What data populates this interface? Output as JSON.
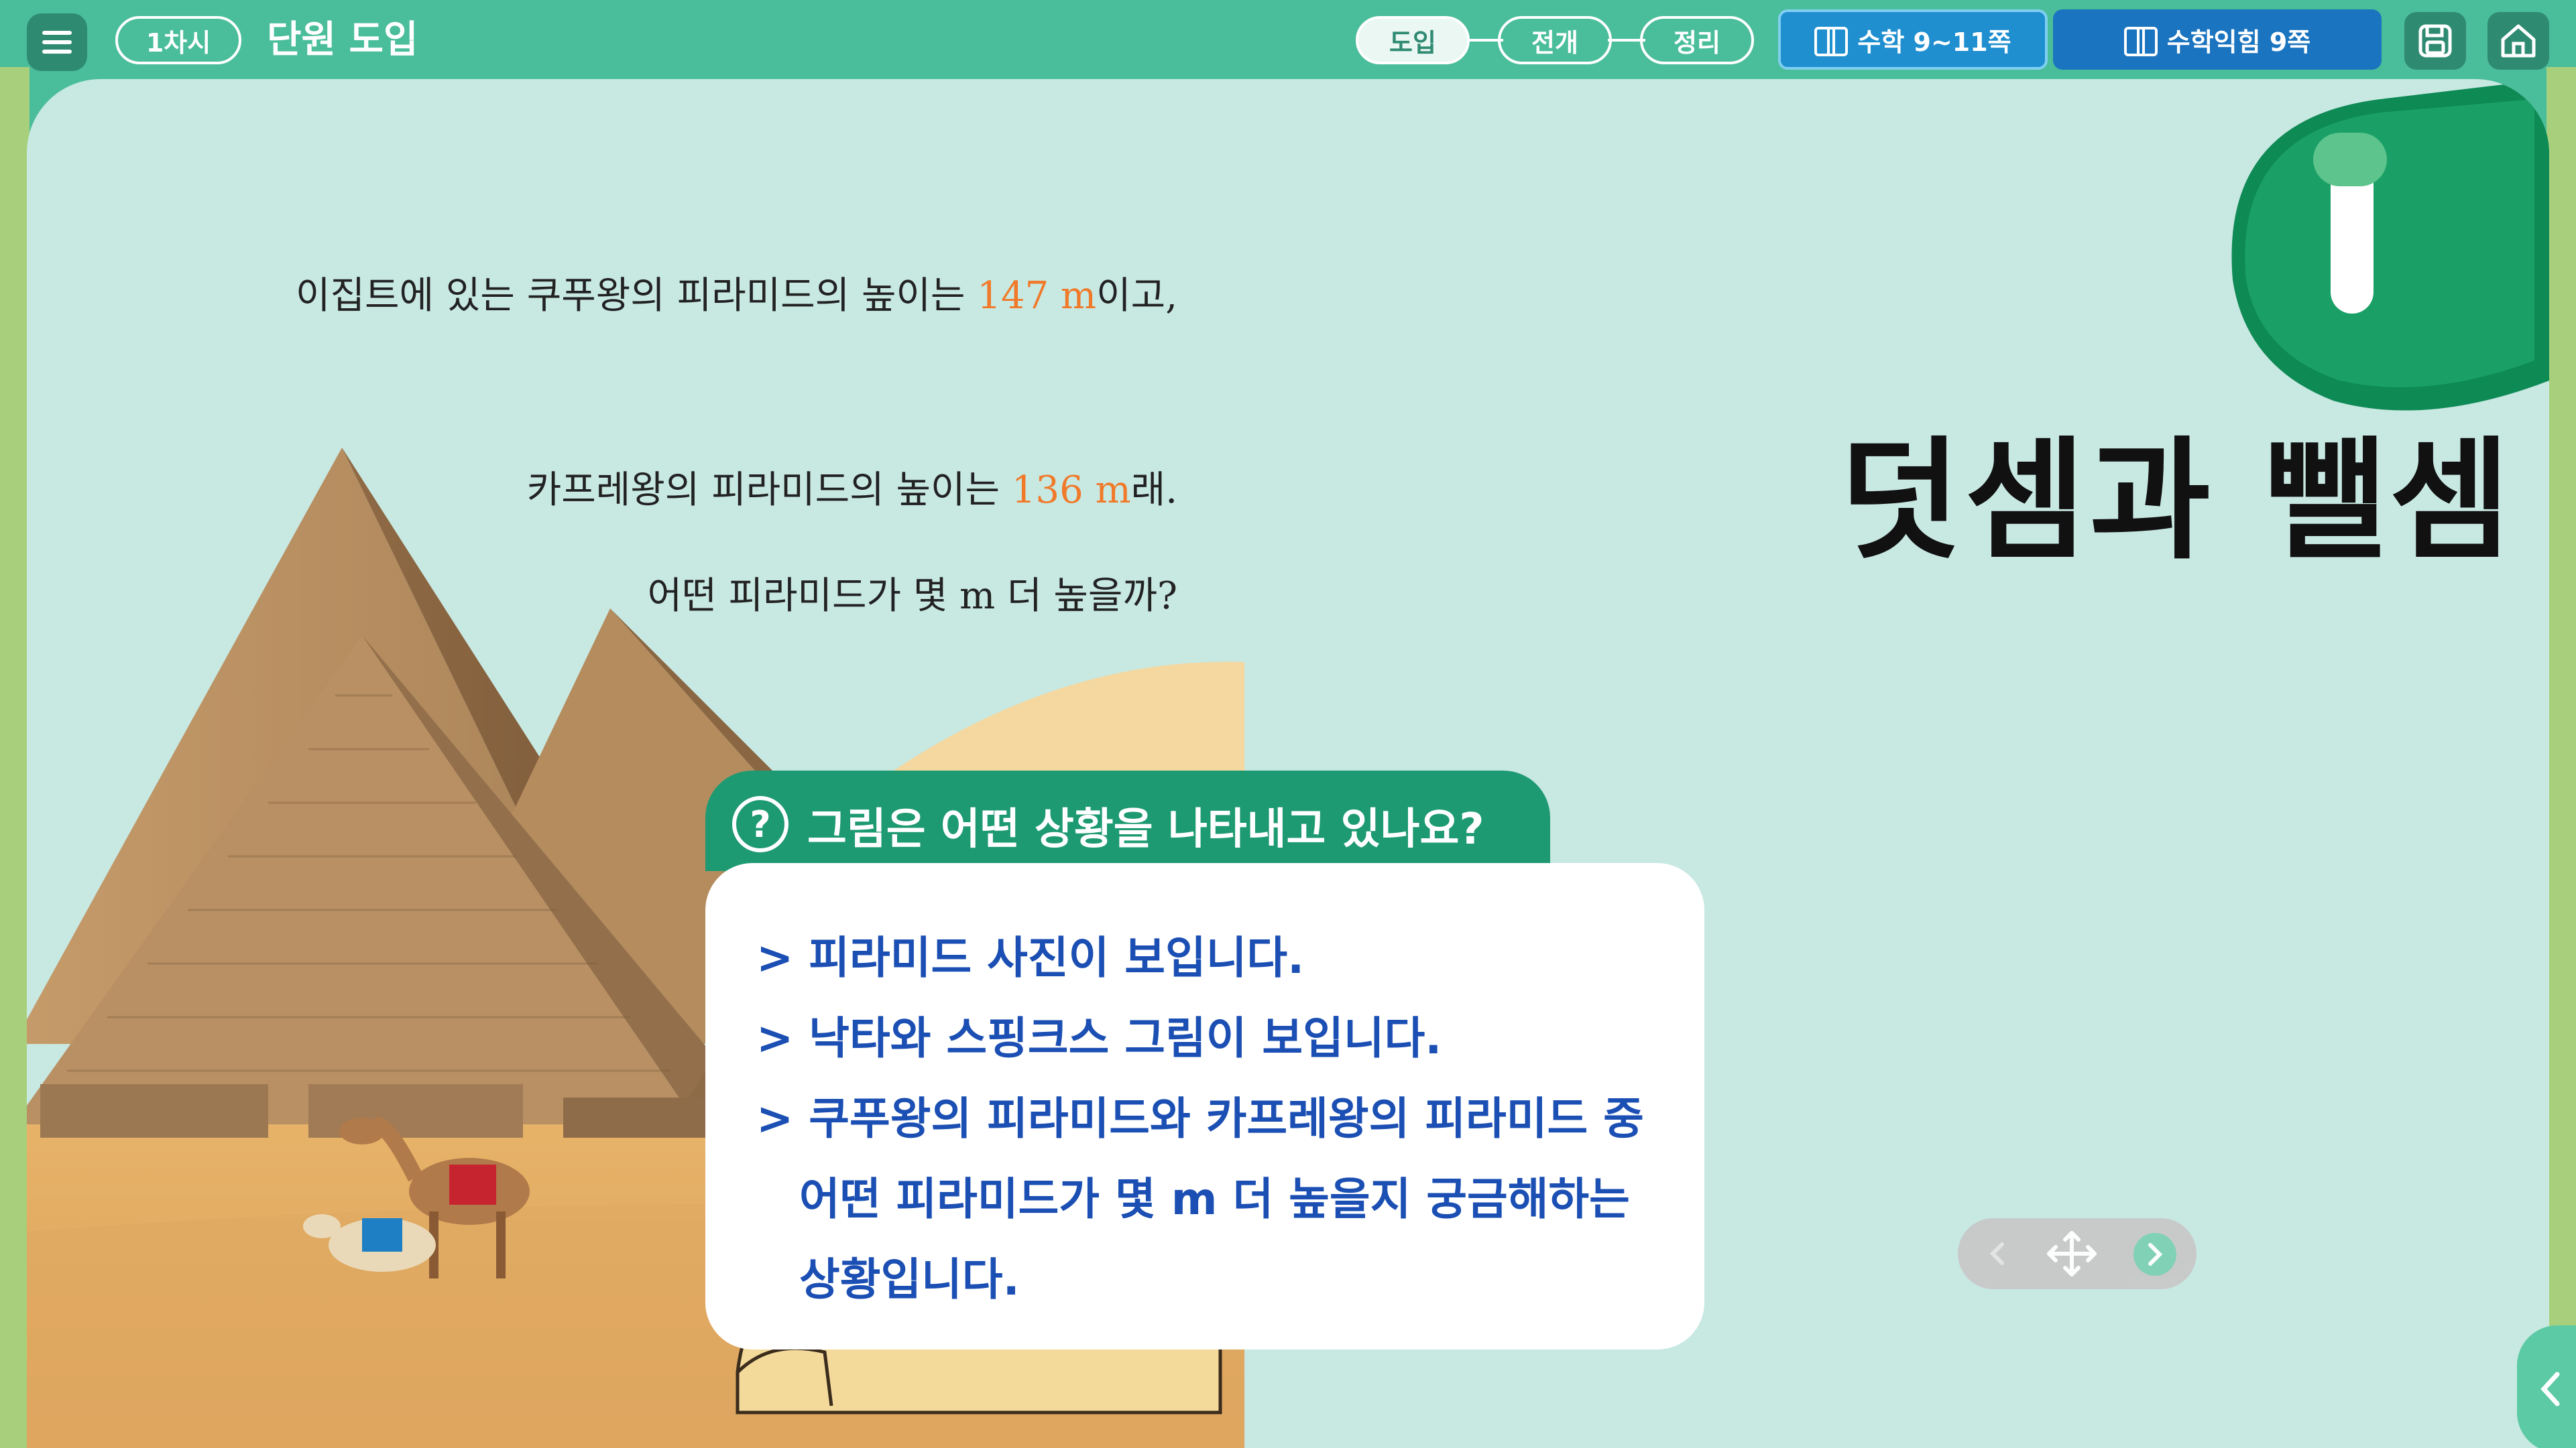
{
  "topbar": {
    "session_label": "1차시",
    "title": "단원 도입",
    "steps": [
      {
        "label": "도입",
        "active": true
      },
      {
        "label": "전개",
        "active": false
      },
      {
        "label": "정리",
        "active": false
      }
    ],
    "book_math_label": "수학 9~11쪽",
    "book_practice_label": "수학익힘 9쪽"
  },
  "question_text": {
    "line1_pre": "이집트에 있는 쿠푸왕의 피라미드의 높이는 ",
    "line1_num": "147 m",
    "line1_post": "이고,",
    "line2_pre": "카프레왕의 피라미드의 높이는 ",
    "line2_num": "136 m",
    "line2_post": "래.",
    "line3": "어떤 피라미드가 몇 m 더 높을까?"
  },
  "unit": {
    "number": "1",
    "title": "덧셈과 뺄셈"
  },
  "question_card": {
    "icon": "?",
    "question": "그림은 어떤 상황을 나타내고 있나요?",
    "answers": [
      "> 피라미드 사진이 보입니다.",
      "> 낙타와 스핑크스 그림이 보입니다.",
      "> 쿠푸왕의 피라미드와 카프레왕의 피라미드 중"
    ],
    "answer3_cont1": "어떤 피라미드가 몇 m 더 높을지 궁금해하는",
    "answer3_cont2": "상황입니다."
  },
  "colors": {
    "topbar": "#4abd9a",
    "panel": "#c8e8e2",
    "accent_orange": "#f07a2a",
    "answer_blue": "#1b4fb3",
    "badge_green": "#1e9a72"
  },
  "icons": {
    "menu": "menu-icon",
    "save": "save-icon",
    "home": "home-icon",
    "book": "book-icon",
    "move": "move-icon",
    "side_toggle": "chevron-left-icon"
  }
}
